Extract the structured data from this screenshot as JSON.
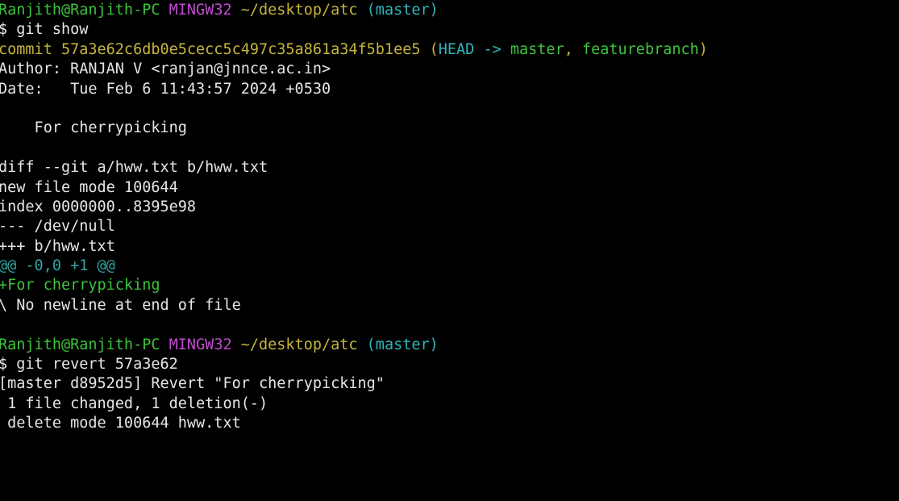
{
  "prompt1": {
    "user_host": "Ranjith@Ranjith-PC",
    "msystem": "MINGW32",
    "path": "~/desktop/atc",
    "branch": "(master)",
    "symbol": "$",
    "command": "git show"
  },
  "commit": {
    "hash_line": "commit 57a3e62c6db0e5cecc5c497c35a861a34f5b1ee5",
    "ref_open": "(",
    "head": "HEAD -> ",
    "master": "master",
    "sep": ", ",
    "feature": "featurebranch",
    "ref_close": ")",
    "author": "Author: RANJAN V <ranjan@jnnce.ac.in>",
    "date": "Date:   Tue Feb 6 11:43:57 2024 +0530",
    "message": "    For cherrypicking"
  },
  "diff": {
    "header": "diff --git a/hww.txt b/hww.txt",
    "mode": "new file mode 100644",
    "index": "index 0000000..8395e98",
    "minus": "--- /dev/null",
    "plus": "+++ b/hww.txt",
    "hunk": "@@ -0,0 +1 @@",
    "added": "+For cherrypicking",
    "no_newline": "\\ No newline at end of file"
  },
  "prompt2": {
    "user_host": "Ranjith@Ranjith-PC",
    "msystem": "MINGW32",
    "path": "~/desktop/atc",
    "branch": "(master)",
    "symbol": "$",
    "command": "git revert 57a3e62"
  },
  "revert": {
    "summary": "[master d8952d5] Revert \"For cherrypicking\"",
    "stats": " 1 file changed, 1 deletion(-)",
    "delete": " delete mode 100644 hww.txt"
  }
}
